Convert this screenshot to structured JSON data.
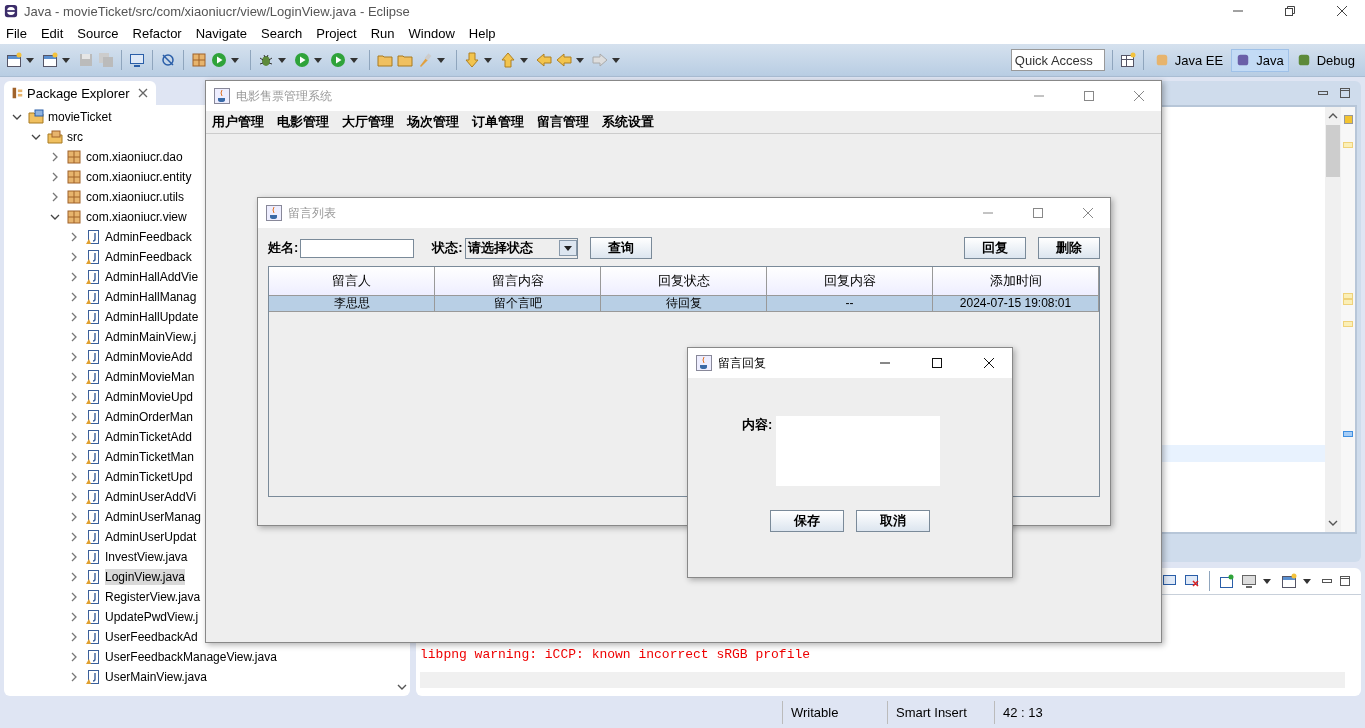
{
  "window": {
    "title": "Java - movieTicket/src/com/xiaoniucr/view/LoginView.java - Eclipse"
  },
  "menu": [
    "File",
    "Edit",
    "Source",
    "Refactor",
    "Navigate",
    "Search",
    "Project",
    "Run",
    "Window",
    "Help"
  ],
  "quick_access": {
    "placeholder": "Quick Access"
  },
  "perspectives": [
    {
      "label": "Java EE",
      "selected": false
    },
    {
      "label": "Java",
      "selected": true
    },
    {
      "label": "Debug",
      "selected": false
    }
  ],
  "package_explorer": {
    "title": "Package Explorer",
    "tree": [
      {
        "label": "movieTicket",
        "kind": "project",
        "expanded": true,
        "selected": false,
        "children": [
          {
            "label": "src",
            "kind": "folder",
            "expanded": true,
            "selected": false,
            "children": [
              {
                "label": "com.xiaoniucr.dao",
                "kind": "package",
                "expanded": false,
                "selected": false
              },
              {
                "label": "com.xiaoniucr.entity",
                "kind": "package",
                "expanded": false,
                "selected": false
              },
              {
                "label": "com.xiaoniucr.utils",
                "kind": "package",
                "expanded": false,
                "selected": false
              },
              {
                "label": "com.xiaoniucr.view",
                "kind": "package",
                "expanded": true,
                "selected": false,
                "children": [
                  {
                    "label": "AdminFeedback",
                    "kind": "file",
                    "expanded": false,
                    "selected": false
                  },
                  {
                    "label": "AdminFeedback",
                    "kind": "file",
                    "expanded": false,
                    "selected": false
                  },
                  {
                    "label": "AdminHallAddVie",
                    "kind": "file",
                    "expanded": false,
                    "selected": false
                  },
                  {
                    "label": "AdminHallManag",
                    "kind": "file",
                    "expanded": false,
                    "selected": false
                  },
                  {
                    "label": "AdminHallUpdate",
                    "kind": "file",
                    "expanded": false,
                    "selected": false
                  },
                  {
                    "label": "AdminMainView.j",
                    "kind": "file",
                    "expanded": false,
                    "selected": false
                  },
                  {
                    "label": "AdminMovieAdd",
                    "kind": "file",
                    "expanded": false,
                    "selected": false
                  },
                  {
                    "label": "AdminMovieMan",
                    "kind": "file",
                    "expanded": false,
                    "selected": false
                  },
                  {
                    "label": "AdminMovieUpd",
                    "kind": "file",
                    "expanded": false,
                    "selected": false
                  },
                  {
                    "label": "AdminOrderMan",
                    "kind": "file",
                    "expanded": false,
                    "selected": false
                  },
                  {
                    "label": "AdminTicketAdd",
                    "kind": "file",
                    "expanded": false,
                    "selected": false
                  },
                  {
                    "label": "AdminTicketMan",
                    "kind": "file",
                    "expanded": false,
                    "selected": false
                  },
                  {
                    "label": "AdminTicketUpd",
                    "kind": "file",
                    "expanded": false,
                    "selected": false
                  },
                  {
                    "label": "AdminUserAddVi",
                    "kind": "file",
                    "expanded": false,
                    "selected": false
                  },
                  {
                    "label": "AdminUserManag",
                    "kind": "file",
                    "expanded": false,
                    "selected": false
                  },
                  {
                    "label": "AdminUserUpdat",
                    "kind": "file",
                    "expanded": false,
                    "selected": false
                  },
                  {
                    "label": "InvestView.java",
                    "kind": "file",
                    "expanded": false,
                    "selected": false
                  },
                  {
                    "label": "LoginView.java",
                    "kind": "file",
                    "expanded": false,
                    "selected": true
                  },
                  {
                    "label": "RegisterView.java",
                    "kind": "file",
                    "expanded": false,
                    "selected": false
                  },
                  {
                    "label": "UpdatePwdView.j",
                    "kind": "file",
                    "expanded": false,
                    "selected": false
                  },
                  {
                    "label": "UserFeedbackAd",
                    "kind": "file",
                    "expanded": false,
                    "selected": false
                  },
                  {
                    "label": "UserFeedbackManageView.java",
                    "kind": "file",
                    "expanded": false,
                    "selected": false
                  },
                  {
                    "label": "UserMainView.java",
                    "kind": "file",
                    "expanded": false,
                    "selected": false
                  }
                ]
              }
            ]
          }
        ]
      }
    ]
  },
  "console": {
    "lines": [
      "libpng warning: iCCP: known incorrect sRGB profile"
    ]
  },
  "status_bar": [
    "Writable",
    "Smart Insert",
    "42 : 13"
  ],
  "app_window": {
    "title": "电影售票管理系统",
    "menu": [
      "用户管理",
      "电影管理",
      "大厅管理",
      "场次管理",
      "订单管理",
      "留言管理",
      "系统设置"
    ]
  },
  "message_list": {
    "title": "留言列表",
    "name_label": "姓名:",
    "status_label": "状态:",
    "status_value": "请选择状态",
    "query_button": "查询",
    "reply_button": "回复",
    "delete_button": "删除",
    "table": {
      "columns": [
        "留言人",
        "留言内容",
        "回复状态",
        "回复内容",
        "添加时间"
      ],
      "rows": [
        {
          "cells": [
            "李思思",
            "留个言吧",
            "待回复",
            "--",
            "2024-07-15 19:08:01"
          ],
          "selected": true
        }
      ]
    }
  },
  "reply_dialog": {
    "title": "留言回复",
    "content_label": "内容:",
    "buttons": [
      "保存",
      "取消"
    ]
  }
}
